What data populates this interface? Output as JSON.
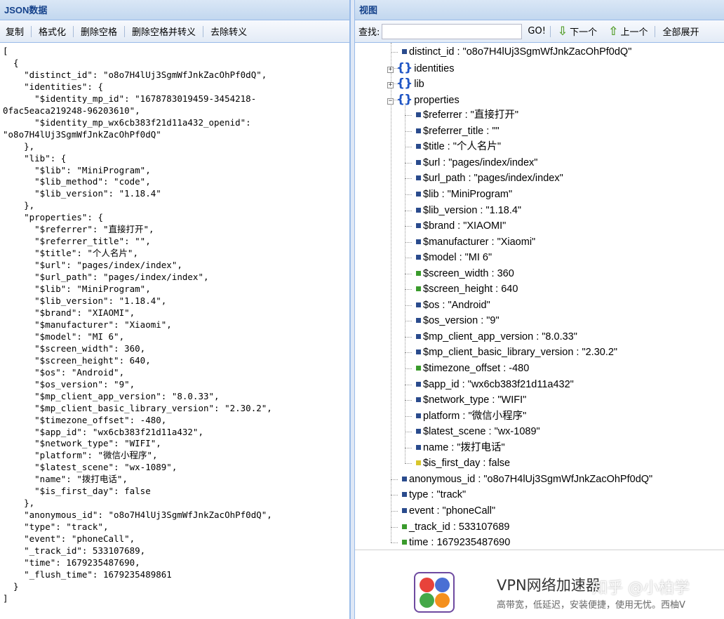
{
  "left_panel": {
    "title": "JSON数据",
    "toolbar": [
      "复制",
      "格式化",
      "删除空格",
      "删除空格并转义",
      "去除转义"
    ],
    "json_text": "[\n  {\n    \"distinct_id\": \"o8o7H4lUj3SgmWfJnkZacOhPf0dQ\",\n    \"identities\": {\n      \"$identity_mp_id\": \"1678783019459-3454218-\n0fac5eaca219248-96203610\",\n      \"$identity_mp_wx6cb383f21d11a432_openid\":\n\"o8o7H4lUj3SgmWfJnkZacOhPf0dQ\"\n    },\n    \"lib\": {\n      \"$lib\": \"MiniProgram\",\n      \"$lib_method\": \"code\",\n      \"$lib_version\": \"1.18.4\"\n    },\n    \"properties\": {\n      \"$referrer\": \"直接打开\",\n      \"$referrer_title\": \"\",\n      \"$title\": \"个人名片\",\n      \"$url\": \"pages/index/index\",\n      \"$url_path\": \"pages/index/index\",\n      \"$lib\": \"MiniProgram\",\n      \"$lib_version\": \"1.18.4\",\n      \"$brand\": \"XIAOMI\",\n      \"$manufacturer\": \"Xiaomi\",\n      \"$model\": \"MI 6\",\n      \"$screen_width\": 360,\n      \"$screen_height\": 640,\n      \"$os\": \"Android\",\n      \"$os_version\": \"9\",\n      \"$mp_client_app_version\": \"8.0.33\",\n      \"$mp_client_basic_library_version\": \"2.30.2\",\n      \"$timezone_offset\": -480,\n      \"$app_id\": \"wx6cb383f21d11a432\",\n      \"$network_type\": \"WIFI\",\n      \"platform\": \"微信小程序\",\n      \"$latest_scene\": \"wx-1089\",\n      \"name\": \"拨打电话\",\n      \"$is_first_day\": false\n    },\n    \"anonymous_id\": \"o8o7H4lUj3SgmWfJnkZacOhPf0dQ\",\n    \"type\": \"track\",\n    \"event\": \"phoneCall\",\n    \"_track_id\": 533107689,\n    \"time\": 1679235487690,\n    \"_flush_time\": 1679235489861\n  }\n]"
  },
  "right_panel": {
    "title": "视图",
    "search": {
      "label": "查找:",
      "value": "",
      "placeholder": ""
    },
    "go_label": "GO!",
    "next_label": "下一个",
    "prev_label": "上一个",
    "expand_all_label": "全部展开",
    "colors": {
      "string": "#2a4b8d",
      "number": "#3a9b2c",
      "boolean": "#d8c62c",
      "object": "#1f55c4"
    },
    "tree": [
      {
        "level": 0,
        "kind": "string",
        "text": "distinct_id : \"o8o7H4lUj3SgmWfJnkZacOhPf0dQ\""
      },
      {
        "level": 0,
        "kind": "object",
        "expanded": false,
        "text": "identities"
      },
      {
        "level": 0,
        "kind": "object",
        "expanded": false,
        "text": "lib"
      },
      {
        "level": 0,
        "kind": "object",
        "expanded": true,
        "text": "properties"
      },
      {
        "level": 1,
        "kind": "string",
        "text": "$referrer : \"直接打开\""
      },
      {
        "level": 1,
        "kind": "string",
        "text": "$referrer_title : \"\""
      },
      {
        "level": 1,
        "kind": "string",
        "text": "$title : \"个人名片\""
      },
      {
        "level": 1,
        "kind": "string",
        "text": "$url : \"pages/index/index\""
      },
      {
        "level": 1,
        "kind": "string",
        "text": "$url_path : \"pages/index/index\""
      },
      {
        "level": 1,
        "kind": "string",
        "text": "$lib : \"MiniProgram\""
      },
      {
        "level": 1,
        "kind": "string",
        "text": "$lib_version : \"1.18.4\""
      },
      {
        "level": 1,
        "kind": "string",
        "text": "$brand : \"XIAOMI\""
      },
      {
        "level": 1,
        "kind": "string",
        "text": "$manufacturer : \"Xiaomi\""
      },
      {
        "level": 1,
        "kind": "string",
        "text": "$model : \"MI 6\""
      },
      {
        "level": 1,
        "kind": "number",
        "text": "$screen_width : 360"
      },
      {
        "level": 1,
        "kind": "number",
        "text": "$screen_height : 640"
      },
      {
        "level": 1,
        "kind": "string",
        "text": "$os : \"Android\""
      },
      {
        "level": 1,
        "kind": "string",
        "text": "$os_version : \"9\""
      },
      {
        "level": 1,
        "kind": "string",
        "text": "$mp_client_app_version : \"8.0.33\""
      },
      {
        "level": 1,
        "kind": "string",
        "text": "$mp_client_basic_library_version : \"2.30.2\""
      },
      {
        "level": 1,
        "kind": "number",
        "text": "$timezone_offset : -480"
      },
      {
        "level": 1,
        "kind": "string",
        "text": "$app_id : \"wx6cb383f21d11a432\""
      },
      {
        "level": 1,
        "kind": "string",
        "text": "$network_type : \"WIFI\""
      },
      {
        "level": 1,
        "kind": "string",
        "text": "platform : \"微信小程序\""
      },
      {
        "level": 1,
        "kind": "string",
        "text": "$latest_scene : \"wx-1089\""
      },
      {
        "level": 1,
        "kind": "string",
        "text": "name : \"拨打电话\""
      },
      {
        "level": 1,
        "kind": "boolean",
        "text": "$is_first_day : false"
      },
      {
        "level": 0,
        "kind": "string",
        "text": "anonymous_id : \"o8o7H4lUj3SgmWfJnkZacOhPf0dQ\""
      },
      {
        "level": 0,
        "kind": "string",
        "text": "type : \"track\""
      },
      {
        "level": 0,
        "kind": "string",
        "text": "event : \"phoneCall\""
      },
      {
        "level": 0,
        "kind": "number",
        "text": "_track_id : 533107689"
      },
      {
        "level": 0,
        "kind": "number",
        "text": "time : 1679235487690"
      }
    ]
  },
  "ad": {
    "title": "VPN网络加速器",
    "description": "高带宽，低延迟，安装便捷，使用无忧。西柚V",
    "watermark": "知乎 @小柏学"
  }
}
